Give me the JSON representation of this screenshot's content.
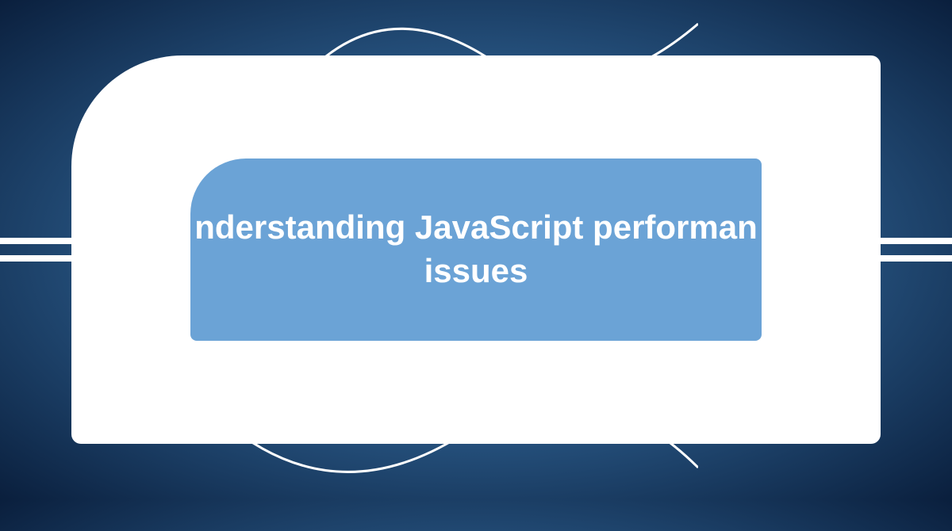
{
  "card": {
    "title_line1": "nderstanding JavaScript performan",
    "title_line2": "issues"
  }
}
